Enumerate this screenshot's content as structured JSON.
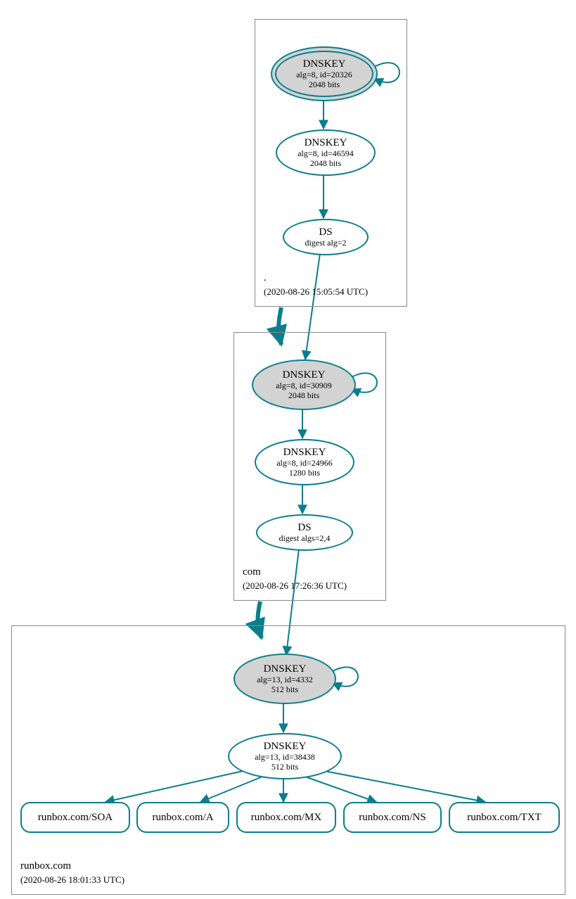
{
  "zones": {
    "root": {
      "name": ".",
      "ts": "(2020-08-26 15:05:54 UTC)"
    },
    "com": {
      "name": "com",
      "ts": "(2020-08-26 17:26:36 UTC)"
    },
    "runbox": {
      "name": "runbox.com",
      "ts": "(2020-08-26 18:01:33 UTC)"
    }
  },
  "nodes": {
    "root_ksk": {
      "title": "DNSKEY",
      "l1": "alg=8, id=20326",
      "l2": "2048 bits"
    },
    "root_zsk": {
      "title": "DNSKEY",
      "l1": "alg=8, id=46594",
      "l2": "2048 bits"
    },
    "root_ds": {
      "title": "DS",
      "l1": "digest alg=2"
    },
    "com_ksk": {
      "title": "DNSKEY",
      "l1": "alg=8, id=30909",
      "l2": "2048 bits"
    },
    "com_zsk": {
      "title": "DNSKEY",
      "l1": "alg=8, id=24966",
      "l2": "1280 bits"
    },
    "com_ds": {
      "title": "DS",
      "l1": "digest algs=2,4"
    },
    "rb_ksk": {
      "title": "DNSKEY",
      "l1": "alg=13, id=4332",
      "l2": "512 bits"
    },
    "rb_zsk": {
      "title": "DNSKEY",
      "l1": "alg=13, id=38438",
      "l2": "512 bits"
    }
  },
  "rrsets": {
    "soa": "runbox.com/SOA",
    "a": "runbox.com/A",
    "mx": "runbox.com/MX",
    "ns": "runbox.com/NS",
    "txt": "runbox.com/TXT"
  },
  "colors": {
    "teal": "#0a7e8c",
    "grey": "#888888"
  }
}
